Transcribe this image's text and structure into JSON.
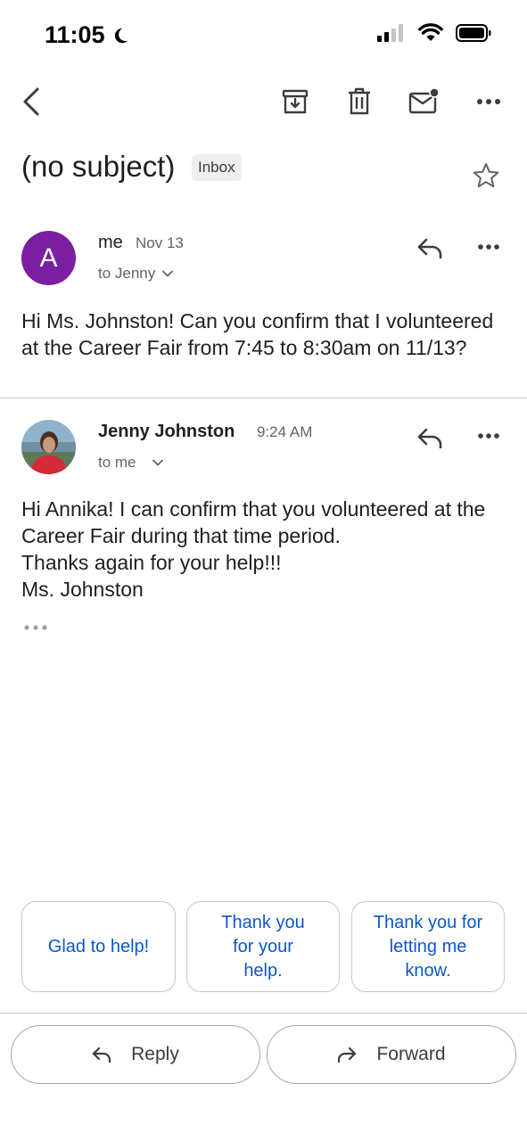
{
  "status_bar": {
    "time": "11:05"
  },
  "email": {
    "subject": "(no subject)",
    "label": "Inbox"
  },
  "messages": [
    {
      "avatar_letter": "A",
      "avatar_color": "#7b1fa2",
      "sender": "me",
      "date": "Nov 13",
      "recipient": "to Jenny",
      "body": [
        "Hi Ms. Johnston! Can you confirm that I volunteered at the Career Fair from 7:45 to 8:30am on 11/13?"
      ]
    },
    {
      "sender": "Jenny Johnston",
      "date": "9:24 AM",
      "recipient": "to me",
      "body": [
        "Hi Annika! I can confirm that you volunteered at the Career Fair during that time period.",
        "Thanks again for your help!!!",
        "Ms. Johnston"
      ]
    }
  ],
  "smart_replies": [
    "Glad to help!",
    "Thank you for your help.",
    "Thank you for letting me know."
  ],
  "actions": {
    "reply": "Reply",
    "forward": "Forward"
  },
  "colors": {
    "accent": "#0b57d0",
    "text": "#1f1f1f",
    "secondary": "#5f6368"
  }
}
